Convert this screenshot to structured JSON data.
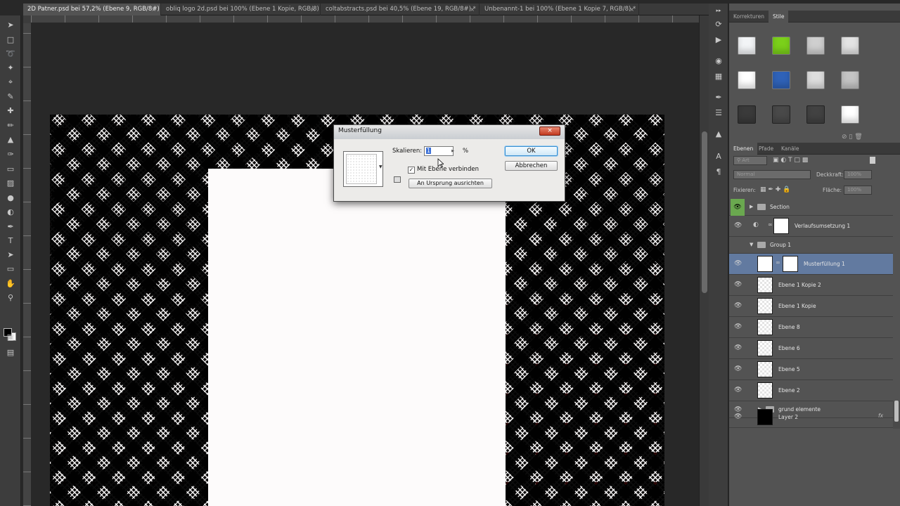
{
  "tabs": [
    {
      "label": "2D Patner.psd bei 57,2% (Ebene 9, RGB/8#) *",
      "active": true
    },
    {
      "label": "obliq logo 2d.psd bei 100% (Ebene 1 Kopie, RGB/8) *",
      "active": false
    },
    {
      "label": "coltabstracts.psd bei 40,5% (Ebene 19, RGB/8#) *",
      "active": false
    },
    {
      "label": "Unbenannt-1 bei 100% (Ebene 1 Kopie 7, RGB/8) *",
      "active": false
    }
  ],
  "tab_close_glyph": "×",
  "tools": [
    "move-tool",
    "marquee-tool",
    "lasso-tool",
    "quick-select-tool",
    "crop-tool",
    "eyedropper-tool",
    "healing-tool",
    "brush-tool",
    "clone-stamp-tool",
    "history-brush-tool",
    "eraser-tool",
    "gradient-tool",
    "blur-tool",
    "dodge-tool",
    "pen-tool",
    "type-tool",
    "path-select-tool",
    "shape-tool",
    "hand-tool",
    "zoom-tool"
  ],
  "dock_icons": [
    "history-icon",
    "actions-icon",
    "color-icon",
    "swatches-icon",
    "brushes-icon",
    "brush-presets-icon",
    "clone-source-icon",
    "character-icon",
    "paragraph-icon"
  ],
  "styles_panel": {
    "tabs": [
      "Korrekturen",
      "Stile"
    ],
    "active_tab": "Stile",
    "tile_colors": [
      "#f2f4f6",
      "#7bd01a",
      "#cfcfcf",
      "#e3e3e3",
      "#ffffff",
      "#2f62b8",
      "#dedede",
      "#c4c4c4",
      "#3a3a3a",
      "#494949",
      "#424242",
      "#ffffff"
    ]
  },
  "layers_panel": {
    "tabs": [
      "Ebenen",
      "Pfade",
      "Kanäle"
    ],
    "active_tab": "Ebenen",
    "filter_label": "Art",
    "blend_mode": "Normal",
    "opacity_label": "Deckkraft:",
    "opacity_value": "100%",
    "lock_label": "Fixieren:",
    "fill_label": "Fläche:",
    "fill_value": "100%",
    "layers": [
      {
        "name": "Section",
        "kind": "group"
      },
      {
        "name": "Verlaufsumsetzung 1",
        "kind": "adjustment"
      },
      {
        "name": "Group 1",
        "kind": "group-open"
      },
      {
        "name": "Musterfüllung 1",
        "kind": "fill",
        "selected": true
      },
      {
        "name": "Ebene 1 Kopie 2",
        "kind": "pixel"
      },
      {
        "name": "Ebene 1 Kopie",
        "kind": "pixel"
      },
      {
        "name": "Ebene 8",
        "kind": "pixel"
      },
      {
        "name": "Ebene 6",
        "kind": "pixel"
      },
      {
        "name": "Ebene 5",
        "kind": "pixel"
      },
      {
        "name": "Ebene 2",
        "kind": "pixel"
      },
      {
        "name": "grund elemente",
        "kind": "group"
      },
      {
        "name": "Layer 2",
        "kind": "black"
      }
    ],
    "fx_label": "fx"
  },
  "dialog": {
    "title": "Musterfüllung",
    "close_glyph": "×",
    "scale_label": "Skalieren:",
    "scale_value": "1",
    "scale_unit": "%",
    "link_checkbox_checked": true,
    "link_label": "Mit Ebene verbinden",
    "snap_button": "An Ursprung ausrichten",
    "ok_button": "OK",
    "cancel_button": "Abbrechen"
  },
  "colors": {
    "selection": "#627aa0",
    "panel_bg": "#535353",
    "accent_ok": "#3b8fd0"
  }
}
